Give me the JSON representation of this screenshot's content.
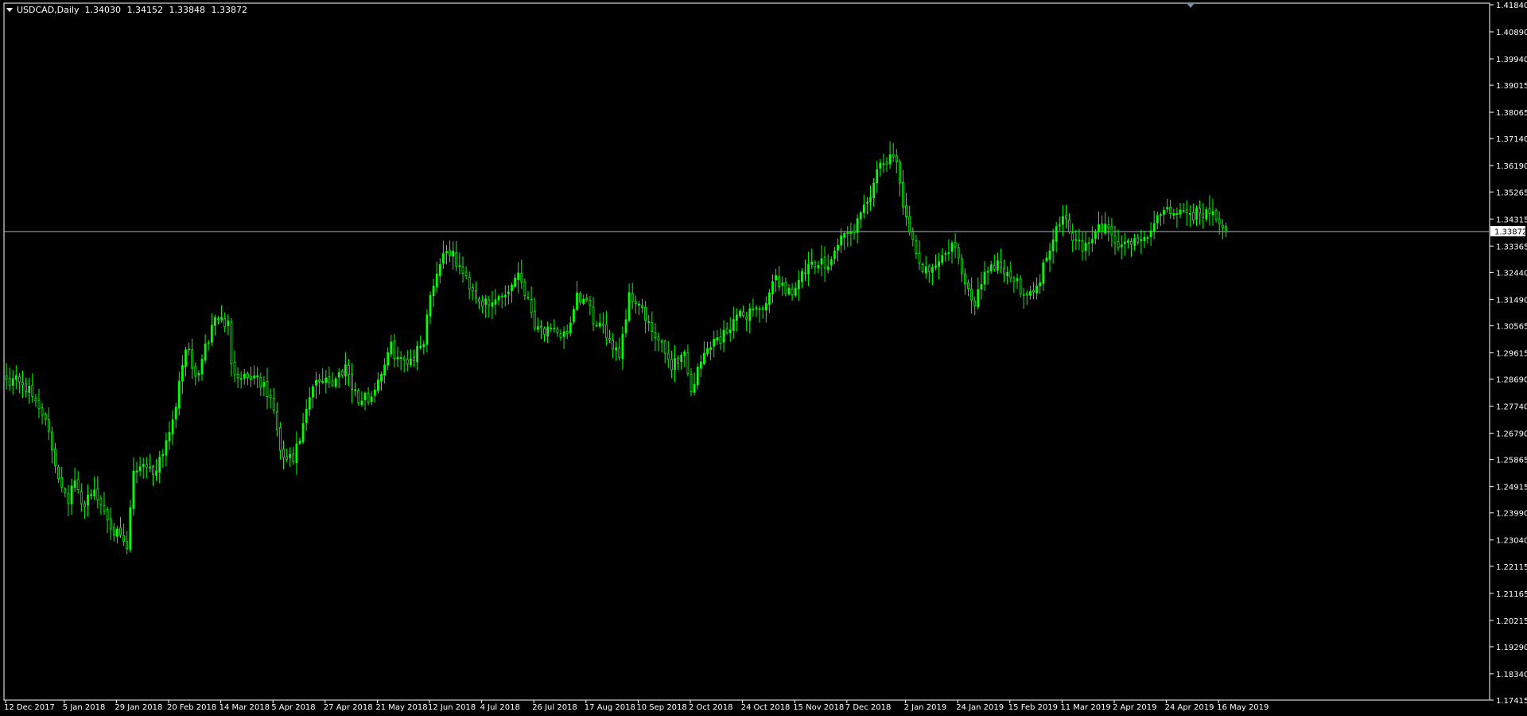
{
  "header": {
    "symbol": "USDCAD,Daily",
    "open": "1.34030",
    "high": "1.34152",
    "low": "1.33848",
    "close": "1.33872"
  },
  "colors": {
    "background": "#000000",
    "axis": "#ffffff",
    "candle": "#00ff00",
    "bid_line": "#b0bcc8",
    "price_tag_bg": "#ffffff",
    "price_tag_fg": "#000000",
    "shift_marker": "#7a8aa0"
  },
  "icons": {
    "menu": "triangle-down",
    "chart_shift": "triangle-down"
  },
  "chart_data": {
    "type": "candlestick",
    "title": "USDCAD,Daily",
    "current_price": "1.33872",
    "current_price_value": 1.33872,
    "ylim": [
      1.17415,
      1.4184
    ],
    "y_ticks": [
      "1.41840",
      "1.40890",
      "1.39940",
      "1.39015",
      "1.38065",
      "1.37140",
      "1.36190",
      "1.35265",
      "1.34315",
      "1.33365",
      "1.32440",
      "1.31490",
      "1.30565",
      "1.29615",
      "1.28690",
      "1.27740",
      "1.26790",
      "1.25865",
      "1.24915",
      "1.23990",
      "1.23040",
      "1.22115",
      "1.21165",
      "1.20215",
      "1.19290",
      "1.18340",
      "1.17415"
    ],
    "x_labels": [
      "12 Dec 2017",
      "5 Jan 2018",
      "29 Jan 2018",
      "20 Feb 2018",
      "14 Mar 2018",
      "5 Apr 2018",
      "27 Apr 2018",
      "21 May 2018",
      "12 Jun 2018",
      "4 Jul 2018",
      "26 Jul 2018",
      "17 Aug 2018",
      "10 Sep 2018",
      "2 Oct 2018",
      "24 Oct 2018",
      "15 Nov 2018",
      "7 Dec 2018",
      "2 Jan 2019",
      "24 Jan 2019",
      "15 Feb 2019",
      "11 Mar 2019",
      "2 Apr 2019",
      "24 Apr 2019",
      "16 May 2019"
    ],
    "close_path": [
      [
        "12 Dec 2017",
        1.287
      ],
      [
        "18 Dec 2017",
        1.287
      ],
      [
        "27 Dec 2017",
        1.276
      ],
      [
        "3 Jan 2018",
        1.253
      ],
      [
        "8 Jan 2018",
        1.245
      ],
      [
        "10 Jan 2018",
        1.251
      ],
      [
        "12 Jan 2018",
        1.242
      ],
      [
        "17 Jan 2018",
        1.248
      ],
      [
        "22 Jan 2018",
        1.243
      ],
      [
        "29 Jan 2018",
        1.232
      ],
      [
        "1 Feb 2018",
        1.227
      ],
      [
        "5 Feb 2018",
        1.254
      ],
      [
        "8 Feb 2018",
        1.258
      ],
      [
        "13 Feb 2018",
        1.254
      ],
      [
        "16 Feb 2018",
        1.262
      ],
      [
        "20 Feb 2018",
        1.269
      ],
      [
        "23 Feb 2018",
        1.284
      ],
      [
        "27 Feb 2018",
        1.299
      ],
      [
        "2 Mar 2018",
        1.287
      ],
      [
        "7 Mar 2018",
        1.297
      ],
      [
        "12 Mar 2018",
        1.309
      ],
      [
        "16 Mar 2018",
        1.306
      ],
      [
        "19 Mar 2018",
        1.291
      ],
      [
        "23 Mar 2018",
        1.288
      ],
      [
        "29 Mar 2018",
        1.288
      ],
      [
        "5 Apr 2018",
        1.277
      ],
      [
        "9 Apr 2018",
        1.26
      ],
      [
        "13 Apr 2018",
        1.258
      ],
      [
        "18 Apr 2018",
        1.27
      ],
      [
        "23 Apr 2018",
        1.284
      ],
      [
        "27 Apr 2018",
        1.288
      ],
      [
        "1 May 2018",
        1.285
      ],
      [
        "7 May 2018",
        1.292
      ],
      [
        "11 May 2018",
        1.279
      ],
      [
        "17 May 2018",
        1.281
      ],
      [
        "21 May 2018",
        1.287
      ],
      [
        "25 May 2018",
        1.298
      ],
      [
        "30 May 2018",
        1.293
      ],
      [
        "5 Jun 2018",
        1.295
      ],
      [
        "8 Jun 2018",
        1.301
      ],
      [
        "12 Jun 2018",
        1.317
      ],
      [
        "15 Jun 2018",
        1.328
      ],
      [
        "19 Jun 2018",
        1.333
      ],
      [
        "22 Jun 2018",
        1.328
      ],
      [
        "27 Jun 2018",
        1.322
      ],
      [
        "3 Jul 2018",
        1.315
      ],
      [
        "6 Jul 2018",
        1.312
      ],
      [
        "11 Jul 2018",
        1.316
      ],
      [
        "16 Jul 2018",
        1.318
      ],
      [
        "19 Jul 2018",
        1.325
      ],
      [
        "23 Jul 2018",
        1.318
      ],
      [
        "26 Jul 2018",
        1.307
      ],
      [
        "31 Jul 2018",
        1.304
      ],
      [
        "6 Aug 2018",
        1.302
      ],
      [
        "10 Aug 2018",
        1.305
      ],
      [
        "14 Aug 2018",
        1.315
      ],
      [
        "17 Aug 2018",
        1.314
      ],
      [
        "22 Aug 2018",
        1.305
      ],
      [
        "27 Aug 2018",
        1.303
      ],
      [
        "31 Aug 2018",
        1.296
      ],
      [
        "5 Sep 2018",
        1.316
      ],
      [
        "10 Sep 2018",
        1.314
      ],
      [
        "13 Sep 2018",
        1.305
      ],
      [
        "18 Sep 2018",
        1.3
      ],
      [
        "24 Sep 2018",
        1.292
      ],
      [
        "28 Sep 2018",
        1.296
      ],
      [
        "2 Oct 2018",
        1.283
      ],
      [
        "5 Oct 2018",
        1.293
      ],
      [
        "10 Oct 2018",
        1.3
      ],
      [
        "15 Oct 2018",
        1.301
      ],
      [
        "19 Oct 2018",
        1.308
      ],
      [
        "24 Oct 2018",
        1.309
      ],
      [
        "29 Oct 2018",
        1.312
      ],
      [
        "2 Nov 2018",
        1.312
      ],
      [
        "7 Nov 2018",
        1.323
      ],
      [
        "12 Nov 2018",
        1.318
      ],
      [
        "15 Nov 2018",
        1.319
      ],
      [
        "20 Nov 2018",
        1.325
      ],
      [
        "26 Nov 2018",
        1.327
      ],
      [
        "30 Nov 2018",
        1.329
      ],
      [
        "5 Dec 2018",
        1.337
      ],
      [
        "10 Dec 2018",
        1.338
      ],
      [
        "14 Dec 2018",
        1.346
      ],
      [
        "19 Dec 2018",
        1.356
      ],
      [
        "24 Dec 2018",
        1.363
      ],
      [
        "28 Dec 2018",
        1.364
      ],
      [
        "2 Jan 2019",
        1.342
      ],
      [
        "4 Jan 2019",
        1.334
      ],
      [
        "8 Jan 2019",
        1.326
      ],
      [
        "14 Jan 2019",
        1.327
      ],
      [
        "18 Jan 2019",
        1.33
      ],
      [
        "22 Jan 2019",
        1.335
      ],
      [
        "24 Jan 2019",
        1.329
      ],
      [
        "28 Jan 2019",
        1.319
      ],
      [
        "31 Jan 2019",
        1.314
      ],
      [
        "5 Feb 2019",
        1.325
      ],
      [
        "11 Feb 2019",
        1.328
      ],
      [
        "15 Feb 2019",
        1.323
      ],
      [
        "20 Feb 2019",
        1.319
      ],
      [
        "26 Feb 2019",
        1.316
      ],
      [
        "4 Mar 2019",
        1.33
      ],
      [
        "7 Mar 2019",
        1.341
      ],
      [
        "11 Mar 2019",
        1.345
      ],
      [
        "15 Mar 2019",
        1.335
      ],
      [
        "20 Mar 2019",
        1.333
      ],
      [
        "26 Mar 2019",
        1.339
      ],
      [
        "29 Mar 2019",
        1.341
      ],
      [
        "2 Apr 2019",
        1.334
      ],
      [
        "8 Apr 2019",
        1.335
      ],
      [
        "12 Apr 2019",
        1.336
      ],
      [
        "17 Apr 2019",
        1.338
      ],
      [
        "22 Apr 2019",
        1.345
      ],
      [
        "24 Apr 2019",
        1.348
      ],
      [
        "29 Apr 2019",
        1.344
      ],
      [
        "3 May 2019",
        1.345
      ],
      [
        "9 May 2019",
        1.345
      ],
      [
        "14 May 2019",
        1.346
      ],
      [
        "16 May 2019",
        1.343
      ],
      [
        "20 May 2019",
        1.3387
      ]
    ]
  }
}
